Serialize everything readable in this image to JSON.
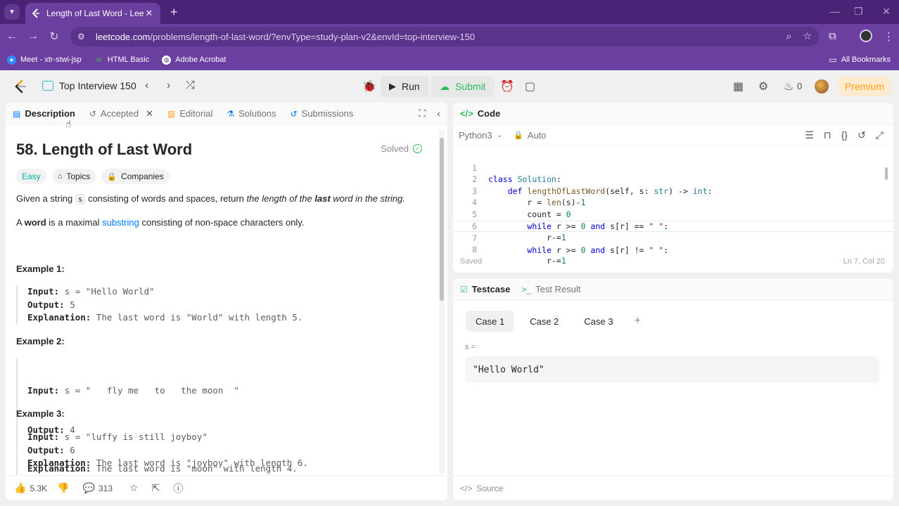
{
  "browser": {
    "tab_title": "Length of Last Word - LeetCode",
    "tab_close": "✕",
    "new_tab": "+",
    "url_host": "leetcode.com",
    "url_path": "/problems/length-of-last-word/?envType=study-plan-v2&envId=top-interview-150",
    "bookmarks": [
      {
        "label": "Meet - xtr-stwi-jsp"
      },
      {
        "label": "HTML Basic"
      },
      {
        "label": "Adobe Acrobat"
      }
    ],
    "all_bookmarks": "All Bookmarks"
  },
  "header": {
    "problem_list": "Top Interview 150",
    "run": "Run",
    "submit": "Submit",
    "streak_count": "0",
    "premium": "Premium"
  },
  "left_tabs": {
    "description": "Description",
    "accepted": "Accepted",
    "editorial": "Editorial",
    "solutions": "Solutions",
    "submissions": "Submissions"
  },
  "problem": {
    "title": "58. Length of Last Word",
    "status": "Solved",
    "difficulty": "Easy",
    "topics": "Topics",
    "companies": "Companies",
    "desc_p1_a": "Given a string ",
    "desc_p1_code": "s",
    "desc_p1_b": " consisting of words and spaces, return ",
    "desc_p1_em1": "the length of the ",
    "desc_p1_strong": "last",
    "desc_p1_em2": " word in the string.",
    "desc_p2_a": "A ",
    "desc_p2_strong": "word",
    "desc_p2_b": " is a maximal ",
    "desc_p2_link": "substring",
    "desc_p2_c": " consisting of non-space characters only.",
    "examples": [
      {
        "heading": "Example 1:",
        "input": "s = \"Hello World\"",
        "output": "5",
        "explanation": "The last word is \"World\" with length 5."
      },
      {
        "heading": "Example 2:",
        "input": "s = \"   fly me   to   the moon  \"",
        "output": "4",
        "explanation": "The last word is \"moon\" with length 4."
      },
      {
        "heading": "Example 3:",
        "input": "s = \"luffy is still joyboy\"",
        "output": "6",
        "explanation": "The last word is \"joyboy\" with length 6."
      }
    ],
    "input_label": "Input:",
    "output_label": "Output:",
    "explanation_label": "Explanation:"
  },
  "footer_left": {
    "likes": "5.3K",
    "comments": "313"
  },
  "code": {
    "tab": "Code",
    "language": "Python3",
    "mode": "Auto",
    "saved": "Saved",
    "cursor_pos": "Ln 7, Col 20",
    "line_numbers": [
      "1",
      "2",
      "3",
      "4",
      "5",
      "6",
      "7",
      "8"
    ]
  },
  "testcase": {
    "tab": "Testcase",
    "result_tab": "Test Result",
    "cases": [
      "Case 1",
      "Case 2",
      "Case 3"
    ],
    "add": "+",
    "var_label": "s =",
    "value": "\"Hello World\"",
    "source": "Source"
  },
  "colors": {
    "brand": "#ffa116",
    "easy": "#00af9b",
    "submit": "#2cbb5d",
    "browser_purple": "#6a3f9f"
  }
}
